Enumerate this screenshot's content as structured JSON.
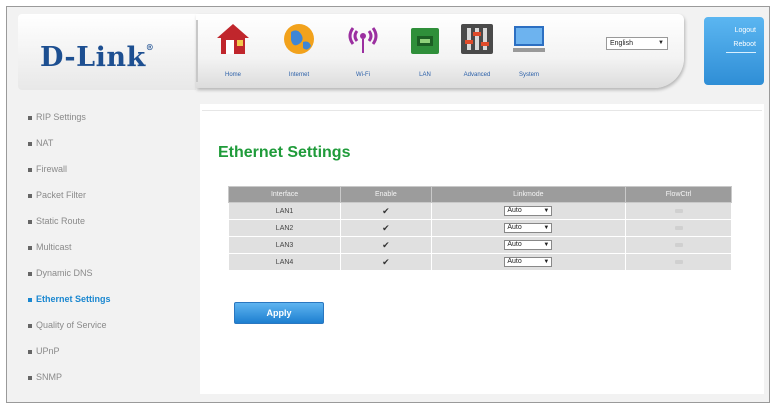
{
  "brand": {
    "logo_text": "D-Link",
    "trademark": "®"
  },
  "nav": {
    "items": [
      {
        "label": "Home",
        "icon": "home-icon"
      },
      {
        "label": "Internet",
        "icon": "globe-icon"
      },
      {
        "label": "Wi-Fi",
        "icon": "wifi-icon"
      },
      {
        "label": "LAN",
        "icon": "lan-icon"
      },
      {
        "label": "Advanced",
        "icon": "advanced-icon"
      },
      {
        "label": "System",
        "icon": "system-icon"
      }
    ]
  },
  "language": {
    "selected": "English"
  },
  "account": {
    "logout": "Logout",
    "reboot": "Reboot"
  },
  "sidebar": {
    "items": [
      {
        "label": "RIP Settings"
      },
      {
        "label": "NAT"
      },
      {
        "label": "Firewall"
      },
      {
        "label": "Packet Filter"
      },
      {
        "label": "Static Route"
      },
      {
        "label": "Multicast"
      },
      {
        "label": "Dynamic DNS"
      },
      {
        "label": "Ethernet Settings"
      },
      {
        "label": "Quality of Service"
      },
      {
        "label": "UPnP"
      },
      {
        "label": "SNMP"
      }
    ]
  },
  "main": {
    "title": "Ethernet Settings",
    "table": {
      "headers": [
        "Interface",
        "Enable",
        "Linkmode",
        "FlowCtrl"
      ],
      "rows": [
        {
          "interface": "LAN1",
          "enable": "✔",
          "linkmode": "Auto"
        },
        {
          "interface": "LAN2",
          "enable": "✔",
          "linkmode": "Auto"
        },
        {
          "interface": "LAN3",
          "enable": "✔",
          "linkmode": "Auto"
        },
        {
          "interface": "LAN4",
          "enable": "✔",
          "linkmode": "Auto"
        }
      ]
    },
    "apply_label": "Apply"
  },
  "colors": {
    "accent_blue": "#1a87d0",
    "title_green": "#1f9b3a",
    "brand_blue": "#1d4f91"
  }
}
